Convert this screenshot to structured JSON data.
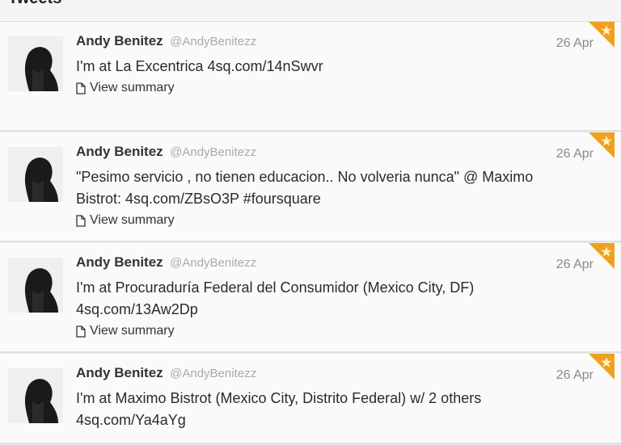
{
  "stream": {
    "title": "Tweets"
  },
  "tweets": [
    {
      "fullname": "Andy Benitez",
      "username": "@AndyBenitezz",
      "time": "26 Apr",
      "text": "I'm at La Excentrica 4sq.com/14nSwvr",
      "summary": "View summary"
    },
    {
      "fullname": "Andy Benitez",
      "username": "@AndyBenitezz",
      "time": "26 Apr",
      "text": "\"Pesimo servicio , no tienen educacion.. No volveria nunca\" @ Maximo Bistrot: 4sq.com/ZBsO3P #foursquare",
      "summary": "View summary"
    },
    {
      "fullname": "Andy Benitez",
      "username": "@AndyBenitezz",
      "time": "26 Apr",
      "text": "I'm at Procuraduría Federal del Consumidor (Mexico City, DF) 4sq.com/13Aw2Dp",
      "summary": "View summary"
    },
    {
      "fullname": "Andy Benitez",
      "username": "@AndyBenitezz",
      "time": "26 Apr",
      "text": "I'm at Maximo Bistrot (Mexico City, Distrito Federal) w/ 2 others 4sq.com/Ya4aYg",
      "summary": ""
    }
  ],
  "colors": {
    "favorite_corner": "#f0a020",
    "star": "#fff3c0"
  },
  "icons": {
    "summary": "document-icon",
    "corner": "star-icon"
  }
}
